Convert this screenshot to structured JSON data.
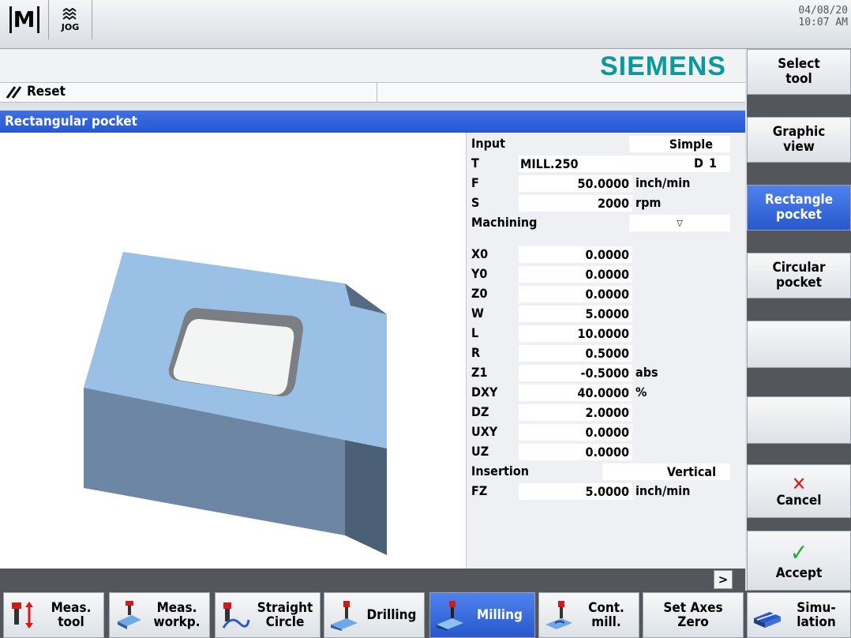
{
  "top": {
    "mode_label": "M",
    "jog_label": "JOG",
    "date": "04/08/20",
    "time": "10:07 AM"
  },
  "header": {
    "brand": "SIEMENS",
    "status": "Reset"
  },
  "dialog": {
    "title": "Rectangular pocket"
  },
  "params": {
    "input_label": "Input",
    "input_value": "Simple",
    "t_label": "T",
    "t_value": "MILL.250",
    "d_label": "D",
    "d_value": "1",
    "f_label": "F",
    "f_value": "50.0000",
    "f_unit": "inch/min",
    "s_label": "S",
    "s_value": "2000",
    "s_unit": "rpm",
    "machining_label": "Machining",
    "machining_value": "▽",
    "x0_label": "X0",
    "x0_value": "0.0000",
    "y0_label": "Y0",
    "y0_value": "0.0000",
    "z0_label": "Z0",
    "z0_value": "0.0000",
    "w_label": "W",
    "w_value": "5.0000",
    "l_label": "L",
    "l_value": "10.0000",
    "r_label": "R",
    "r_value": "0.5000",
    "z1_label": "Z1",
    "z1_value": "-0.5000",
    "z1_unit": "abs",
    "dxy_label": "DXY",
    "dxy_value": "40.0000",
    "dxy_unit": "%",
    "dz_label": "DZ",
    "dz_value": "2.0000",
    "uxy_label": "UXY",
    "uxy_value": "0.0000",
    "uz_label": "UZ",
    "uz_value": "0.0000",
    "insertion_label": "Insertion",
    "insertion_value": "Vertical",
    "fz_label": "FZ",
    "fz_value": "5.0000",
    "fz_unit": "inch/min"
  },
  "more_button": ">",
  "right_keys": [
    {
      "line1": "Select",
      "line2": "tool"
    },
    {
      "line1": "Graphic",
      "line2": "view"
    },
    {
      "line1": "Rectangle",
      "line2": "pocket"
    },
    {
      "line1": "Circular",
      "line2": "pocket"
    },
    {
      "line1": "",
      "line2": ""
    },
    {
      "line1": "",
      "line2": ""
    },
    {
      "label": "Cancel",
      "icon": "✕"
    },
    {
      "label": "Accept",
      "icon": "✓"
    }
  ],
  "bottom_keys": [
    {
      "line1": "Meas.",
      "line2": "tool"
    },
    {
      "line1": "Meas.",
      "line2": "workp."
    },
    {
      "line1": "Straight",
      "line2": "Circle"
    },
    {
      "line1": "Drilling"
    },
    {
      "line1": "Milling"
    },
    {
      "line1": "Cont.",
      "line2": "mill."
    },
    {
      "line1": "Set Axes",
      "line2": "Zero"
    },
    {
      "line1": "Simu-",
      "line2": "lation"
    }
  ],
  "colors": {
    "accent_blue": "#2f62d8",
    "brand_teal": "#0a9a9c",
    "cancel_red": "#e0161c",
    "accept_green": "#2aa63a",
    "block_top": "#9bc0e6",
    "block_side": "#647c96"
  }
}
